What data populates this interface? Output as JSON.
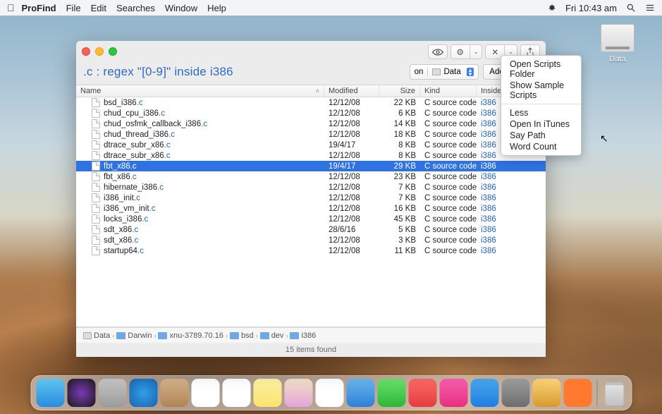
{
  "menubar": {
    "app": "ProFind",
    "items": [
      "File",
      "Edit",
      "Searches",
      "Window",
      "Help"
    ],
    "clock": "Fri 10:43 am"
  },
  "desktop": {
    "drive_label": "Data"
  },
  "window": {
    "query_prefix": ".c : ",
    "query_regex": "regex ",
    "query_quote1": "\"",
    "query_pattern": "[0-9]",
    "query_quote2": "\" ",
    "query_inside": "inside ",
    "query_target": "i386",
    "scope_on": "on",
    "scope_vol": "Data",
    "add_criteria": "Add Criteria",
    "columns": {
      "name": "Name",
      "modified": "Modified",
      "size": "Size",
      "kind": "Kind",
      "inside": "Inside"
    },
    "rows": [
      {
        "name": "bsd_i386",
        "ext": ".c",
        "mod": "12/12/08",
        "size": "22 KB",
        "kind": "C source code",
        "inside": "i386",
        "sel": false
      },
      {
        "name": "chud_cpu_i386",
        "ext": ".c",
        "mod": "12/12/08",
        "size": "6 KB",
        "kind": "C source code",
        "inside": "i386",
        "sel": false
      },
      {
        "name": "chud_osfmk_callback_i386",
        "ext": ".c",
        "mod": "12/12/08",
        "size": "14 KB",
        "kind": "C source code",
        "inside": "i386",
        "sel": false
      },
      {
        "name": "chud_thread_i386",
        "ext": ".c",
        "mod": "12/12/08",
        "size": "18 KB",
        "kind": "C source code",
        "inside": "i386",
        "sel": false
      },
      {
        "name": "dtrace_subr_x86",
        "ext": ".c",
        "mod": "19/4/17",
        "size": "8 KB",
        "kind": "C source code",
        "inside": "i386",
        "sel": false
      },
      {
        "name": "dtrace_subr_x86",
        "ext": ".c",
        "mod": "12/12/08",
        "size": "8 KB",
        "kind": "C source code",
        "inside": "i386",
        "sel": false
      },
      {
        "name": "fbt_x86",
        "ext": ".c",
        "mod": "19/4/17",
        "size": "29 KB",
        "kind": "C source code",
        "inside": "i386",
        "sel": true
      },
      {
        "name": "fbt_x86",
        "ext": ".c",
        "mod": "12/12/08",
        "size": "23 KB",
        "kind": "C source code",
        "inside": "i386",
        "sel": false
      },
      {
        "name": "hibernate_i386",
        "ext": ".c",
        "mod": "12/12/08",
        "size": "7 KB",
        "kind": "C source code",
        "inside": "i386",
        "sel": false
      },
      {
        "name": "i386_init",
        "ext": ".c",
        "mod": "12/12/08",
        "size": "7 KB",
        "kind": "C source code",
        "inside": "i386",
        "sel": false
      },
      {
        "name": "i386_vm_init",
        "ext": ".c",
        "mod": "12/12/08",
        "size": "16 KB",
        "kind": "C source code",
        "inside": "i386",
        "sel": false
      },
      {
        "name": "locks_i386",
        "ext": ".c",
        "mod": "12/12/08",
        "size": "45 KB",
        "kind": "C source code",
        "inside": "i386",
        "sel": false
      },
      {
        "name": "sdt_x86",
        "ext": ".c",
        "mod": "28/6/16",
        "size": "5 KB",
        "kind": "C source code",
        "inside": "i386",
        "sel": false
      },
      {
        "name": "sdt_x86",
        "ext": ".c",
        "mod": "12/12/08",
        "size": "3 KB",
        "kind": "C source code",
        "inside": "i386",
        "sel": false
      },
      {
        "name": "startup64",
        "ext": ".c",
        "mod": "12/12/08",
        "size": "11 KB",
        "kind": "C source code",
        "inside": "i386",
        "sel": false
      }
    ],
    "path": [
      "Data",
      "Darwin",
      "xnu-3789.70.16",
      "bsd",
      "dev",
      "i386"
    ],
    "status": "15 items found"
  },
  "menu_popup": {
    "group1": [
      "Open Scripts Folder",
      "Show Sample Scripts"
    ],
    "group2": [
      "Less",
      "Open In iTunes",
      "Say Path",
      "Word Count"
    ]
  },
  "dock": {
    "apps": [
      {
        "name": "finder",
        "bg": "linear-gradient(#5ec4ef,#2a8cde)"
      },
      {
        "name": "siri",
        "bg": "radial-gradient(circle,#7a3ab5,#1a1a1a)"
      },
      {
        "name": "launchpad",
        "bg": "linear-gradient(#c7c7c7,#9a9a9a)"
      },
      {
        "name": "safari",
        "bg": "radial-gradient(circle,#2ea0e6,#1b63b0)"
      },
      {
        "name": "contacts",
        "bg": "linear-gradient(#d6b28b,#b08456)"
      },
      {
        "name": "calendar",
        "bg": "#fff"
      },
      {
        "name": "reminders",
        "bg": "#fff"
      },
      {
        "name": "notes",
        "bg": "linear-gradient(#fff3a6,#f9e26b)"
      },
      {
        "name": "maps",
        "bg": "linear-gradient(#f2e4c8,#e5a3d9)"
      },
      {
        "name": "photos",
        "bg": "#fff"
      },
      {
        "name": "mail",
        "bg": "linear-gradient(#6bb8ef,#2d7fd6)"
      },
      {
        "name": "messages",
        "bg": "linear-gradient(#6be46c,#2db53a)"
      },
      {
        "name": "news",
        "bg": "linear-gradient(#ff6a6a,#e43d3d)"
      },
      {
        "name": "music",
        "bg": "linear-gradient(#fb5fb1,#e6307f)"
      },
      {
        "name": "appstore",
        "bg": "linear-gradient(#4aa8ef,#1f7de0)"
      },
      {
        "name": "preferences",
        "bg": "linear-gradient(#a0a0a0,#6c6c6c)"
      },
      {
        "name": "profind",
        "bg": "linear-gradient(#ffd37a,#d59a2e)"
      },
      {
        "name": "binoculars",
        "bg": "#ff7a2e"
      }
    ]
  }
}
